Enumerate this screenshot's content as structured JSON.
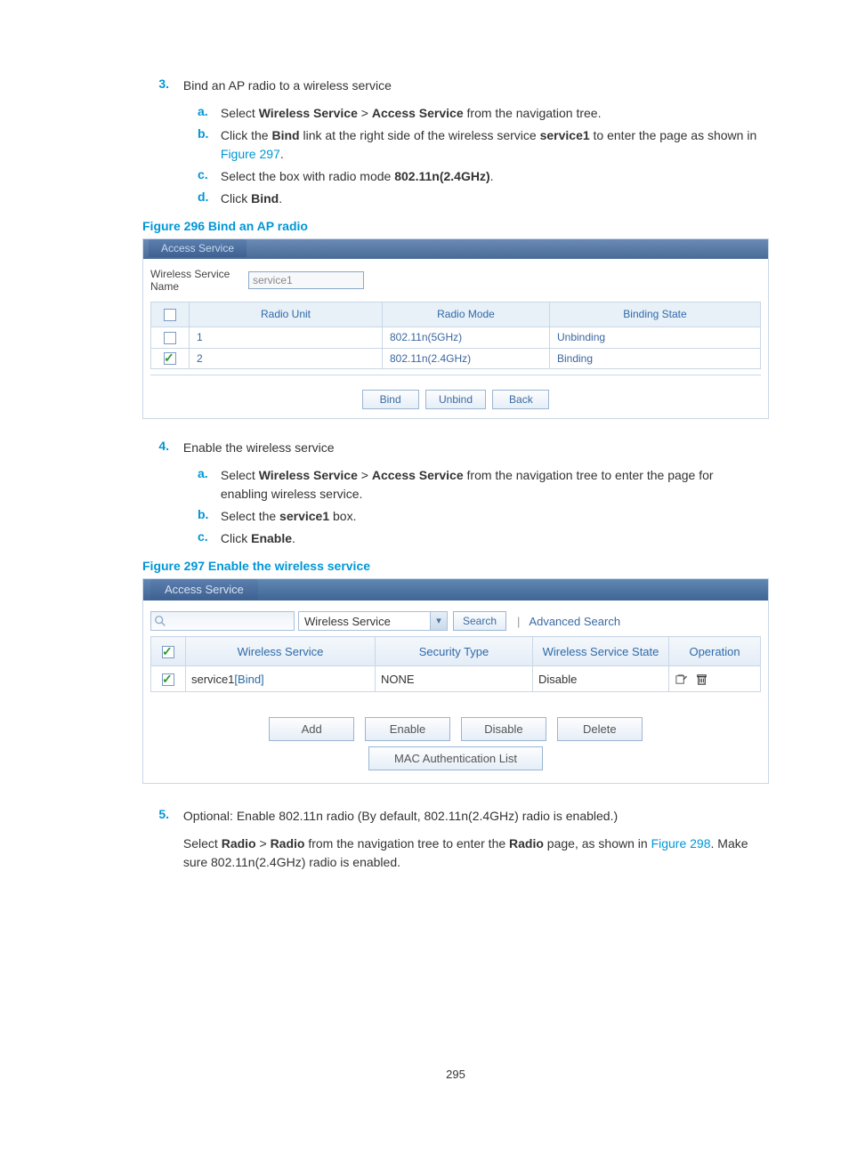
{
  "step3": {
    "num": "3.",
    "title": "Bind an AP radio to a wireless service",
    "a": {
      "l": "a.",
      "t1": "Select ",
      "b1": "Wireless Service",
      "gt": " > ",
      "b2": "Access Service",
      "t2": " from the navigation tree."
    },
    "b": {
      "l": "b.",
      "t1": "Click the ",
      "b1": "Bind",
      "t2": " link at the right side of the wireless service ",
      "b2": "service1",
      "t3": " to enter the page as shown in ",
      "fig": "Figure 297",
      "t4": "."
    },
    "c": {
      "l": "c.",
      "t1": "Select the box with radio mode ",
      "b1": "802.11n(2.4GHz)",
      "t2": "."
    },
    "d": {
      "l": "d.",
      "t1": "Click ",
      "b1": "Bind",
      "t2": "."
    }
  },
  "fig296": {
    "title": "Figure 296 Bind an AP radio",
    "tab": "Access Service",
    "field_label": "Wireless Service Name",
    "field_value": "service1",
    "th_unit": "Radio Unit",
    "th_mode": "Radio Mode",
    "th_state": "Binding State",
    "rows": [
      {
        "unit": "1",
        "mode": "802.11n(5GHz)",
        "state": "Unbinding",
        "checked": false
      },
      {
        "unit": "2",
        "mode": "802.11n(2.4GHz)",
        "state": "Binding",
        "checked": true
      }
    ],
    "btn_bind": "Bind",
    "btn_unbind": "Unbind",
    "btn_back": "Back"
  },
  "step4": {
    "num": "4.",
    "title": "Enable the wireless service",
    "a": {
      "l": "a.",
      "t1": "Select ",
      "b1": "Wireless Service",
      "gt": " > ",
      "b2": "Access Service",
      "t2": " from the navigation tree to enter the page for enabling wireless service."
    },
    "b": {
      "l": "b.",
      "t1": "Select the ",
      "b1": "service1",
      "t2": " box."
    },
    "c": {
      "l": "c.",
      "t1": "Click ",
      "b1": "Enable",
      "t2": "."
    }
  },
  "fig297": {
    "title": "Figure 297 Enable the wireless service",
    "tab": "Access Service",
    "select_value": "Wireless Service",
    "btn_search": "Search",
    "adv_search": "Advanced Search",
    "th_ws": "Wireless Service",
    "th_sec": "Security Type",
    "th_state": "Wireless Service State",
    "th_op": "Operation",
    "row": {
      "ws_name": "service1",
      "ws_link": "[Bind]",
      "sec": "NONE",
      "state": "Disable"
    },
    "btn_add": "Add",
    "btn_enable": "Enable",
    "btn_disable": "Disable",
    "btn_delete": "Delete",
    "btn_mac": "MAC Authentication List"
  },
  "step5": {
    "num": "5.",
    "line1": "Optional: Enable 802.11n radio (By default, 802.11n(2.4GHz) radio is enabled.)",
    "l2_t1": "Select ",
    "l2_b1": "Radio",
    "l2_gt": " > ",
    "l2_b2": "Radio",
    "l2_t2": " from the navigation tree to enter the ",
    "l2_b3": "Radio",
    "l2_t3": " page, as shown in ",
    "l2_fig": "Figure 298",
    "l2_t4": ". Make sure 802.11n(2.4GHz) radio is enabled."
  },
  "page_number": "295"
}
